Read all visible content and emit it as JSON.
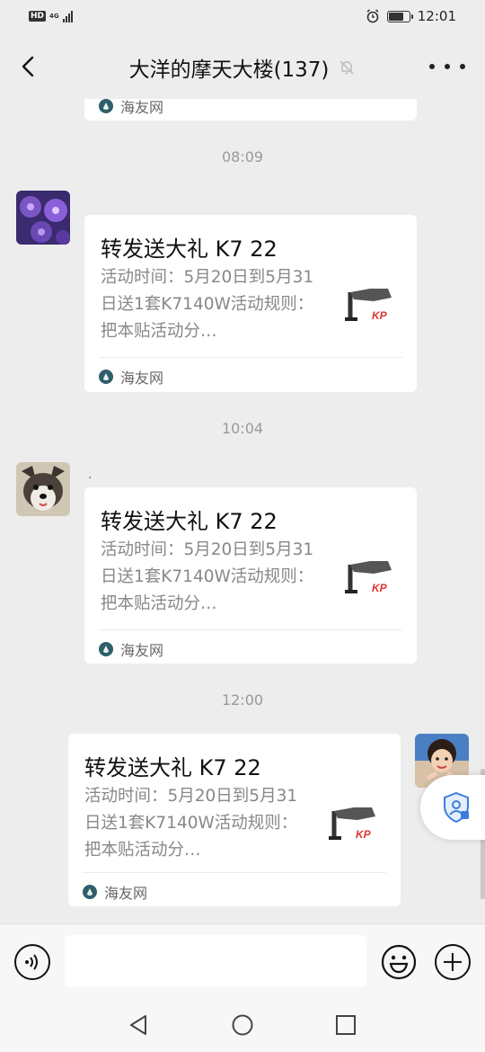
{
  "status_bar": {
    "hd": "HD",
    "network": "4G",
    "time": "12:01",
    "battery_level": 0.75
  },
  "header": {
    "title": "大洋的摩天大楼(137)",
    "muted_icon": "bell-muted-icon"
  },
  "chat": {
    "messages": [
      {
        "type": "link-card-fragment",
        "source": "海友网"
      },
      {
        "time": "08:09",
        "sender": "other",
        "avatar": "coral-avatar",
        "card": {
          "title": "转发送大礼 K7 22",
          "desc": "活动时间：5月20日到5月31日送1套K7140W活动规则：把本贴活动分…",
          "thumb_icon": "aquarium-light-thumbnail",
          "source": "海友网"
        }
      },
      {
        "time": "10:04",
        "sender": "other",
        "avatar": "dog-avatar",
        "nickname": ".",
        "card": {
          "title": "转发送大礼 K7 22",
          "desc": "活动时间：5月20日到5月31日送1套K7140W活动规则：把本贴活动分…",
          "thumb_icon": "aquarium-light-thumbnail",
          "source": "海友网"
        }
      },
      {
        "time": "12:00",
        "sender": "self",
        "avatar": "girl-avatar",
        "card": {
          "title": "转发送大礼 K7 22",
          "desc": "活动时间：5月20日到5月31日送1套K7140W活动规则：把本贴活动分…",
          "thumb_icon": "aquarium-light-thumbnail",
          "source": "海友网"
        }
      }
    ]
  },
  "input_bar": {
    "placeholder": "",
    "voice_icon": "voice-icon",
    "emoji_icon": "emoji-icon",
    "plus_icon": "plus-icon"
  },
  "colors": {
    "background": "#ededed",
    "card": "#ffffff",
    "muted_text": "#888888"
  }
}
